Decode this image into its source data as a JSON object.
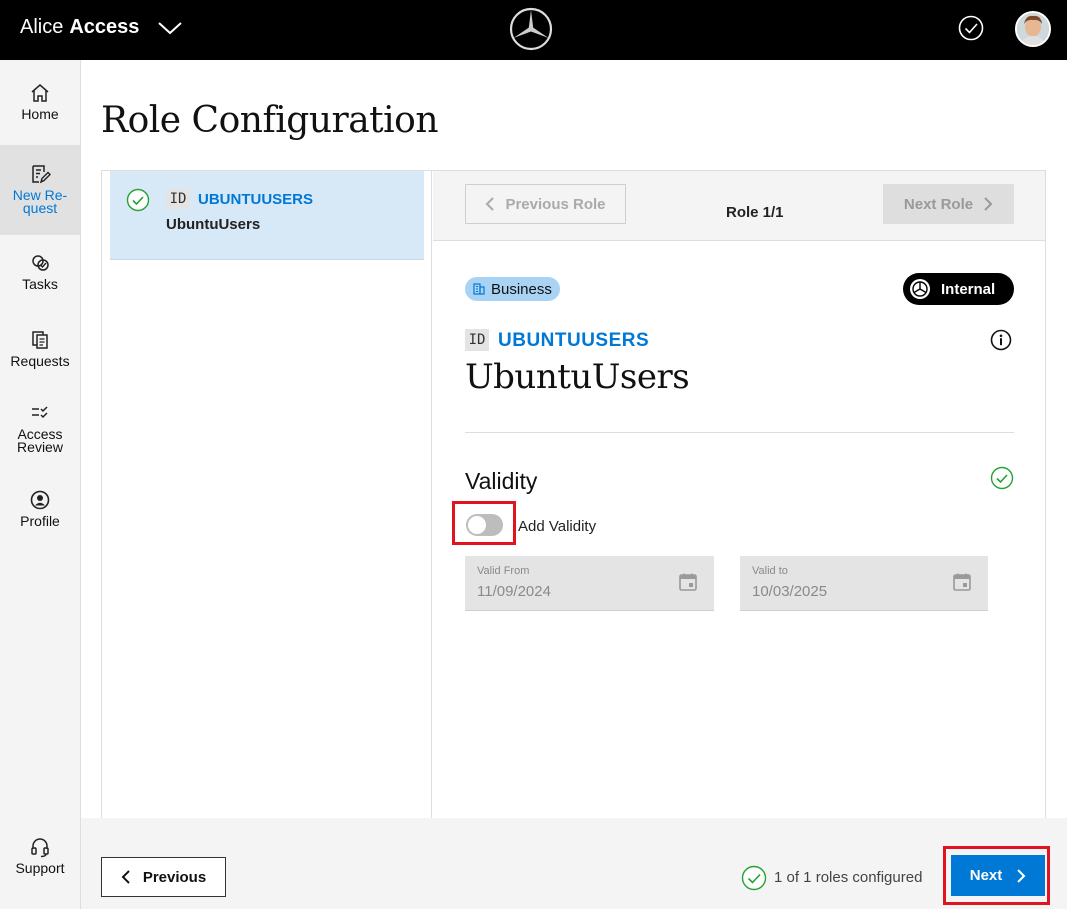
{
  "header": {
    "app_name_light": "Alice",
    "app_name_bold": "Access",
    "logo": "mercedes-star-icon",
    "status_icon": "check-circle-icon",
    "avatar": "user-avatar"
  },
  "sidebar": {
    "items": [
      {
        "label": "Home",
        "icon": "home-icon"
      },
      {
        "label": "New Re-quest",
        "icon": "edit-document-icon"
      },
      {
        "label": "Tasks",
        "icon": "tasks-icon"
      },
      {
        "label": "Requests",
        "icon": "copy-documents-icon"
      },
      {
        "label": "Access Review",
        "icon": "checklist-icon"
      },
      {
        "label": "Profile",
        "icon": "profile-icon"
      },
      {
        "label": "Support",
        "icon": "headset-icon"
      }
    ],
    "labels": {
      "home": "Home",
      "new_request_1": "New Re-",
      "new_request_2": "quest",
      "tasks": "Tasks",
      "requests": "Requests",
      "access_review_1": "Access",
      "access_review_2": "Review",
      "profile": "Profile",
      "support": "Support"
    }
  },
  "page": {
    "title": "Role Configuration"
  },
  "role_list": [
    {
      "id_tag": "ID",
      "id": "UBUNTUUSERS",
      "name": "UbuntuUsers",
      "configured": true
    }
  ],
  "role_nav": {
    "previous_label": "Previous Role",
    "count": "Role 1/1",
    "next_label": "Next Role"
  },
  "role_detail": {
    "category": "Business",
    "scope": "Internal",
    "id_tag": "ID",
    "id": "UBUNTUUSERS",
    "name": "UbuntuUsers"
  },
  "validity": {
    "title": "Validity",
    "toggle_label": "Add Validity",
    "toggle_on": false,
    "valid_from": {
      "label": "Valid From",
      "value": "11/09/2024"
    },
    "valid_to": {
      "label": "Valid to",
      "value": "10/03/2025"
    }
  },
  "footer": {
    "previous_label": "Previous",
    "status": "1 of 1 roles configured",
    "next_label": "Next"
  },
  "colors": {
    "accent": "#0078d6",
    "highlight": "#e0141e",
    "success": "#21a330",
    "selected_bg": "#d7e8f6"
  }
}
